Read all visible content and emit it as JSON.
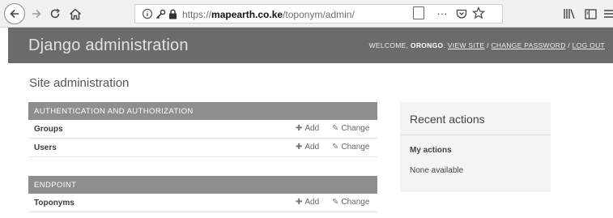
{
  "browser": {
    "url_prefix": "https://",
    "url_domain": "mapearth.co.ke",
    "url_path": "/toponym/admin/",
    "overflow_label": "···"
  },
  "header": {
    "brand": "Django administration",
    "welcome": "WELCOME, ",
    "username": "ORONGO",
    "view_site": "VIEW SITE",
    "change_password": "CHANGE PASSWORD",
    "log_out": "LOG OUT",
    "separator": " / "
  },
  "page": {
    "title": "Site administration"
  },
  "modules": [
    {
      "caption": "AUTHENTICATION AND AUTHORIZATION",
      "models": [
        {
          "name": "Groups",
          "add_label": "Add",
          "change_label": "Change"
        },
        {
          "name": "Users",
          "add_label": "Add",
          "change_label": "Change"
        }
      ]
    },
    {
      "caption": "ENDPOINT",
      "models": [
        {
          "name": "Toponyms",
          "add_label": "Add",
          "change_label": "Change"
        }
      ]
    }
  ],
  "recent_actions": {
    "title": "Recent actions",
    "subtitle": "My actions",
    "empty_text": "None available"
  },
  "icons": {
    "back": "back-arrow-icon",
    "forward": "forward-arrow-icon",
    "reload": "reload-icon",
    "home": "home-icon",
    "info": "info-icon",
    "key": "key-icon",
    "lock": "lock-icon",
    "reader": "reader-view-icon",
    "pocket": "pocket-icon",
    "bookmark": "bookmark-star-icon",
    "library": "library-icon",
    "sidebar": "sidebar-icon",
    "menu": "hamburger-menu-icon",
    "add": "plus-icon",
    "change": "pencil-icon"
  },
  "colors": {
    "header_bg": "#6b6b6b",
    "module_caption_bg": "#8e8e8e",
    "recent_bg": "#f4f4f4"
  }
}
